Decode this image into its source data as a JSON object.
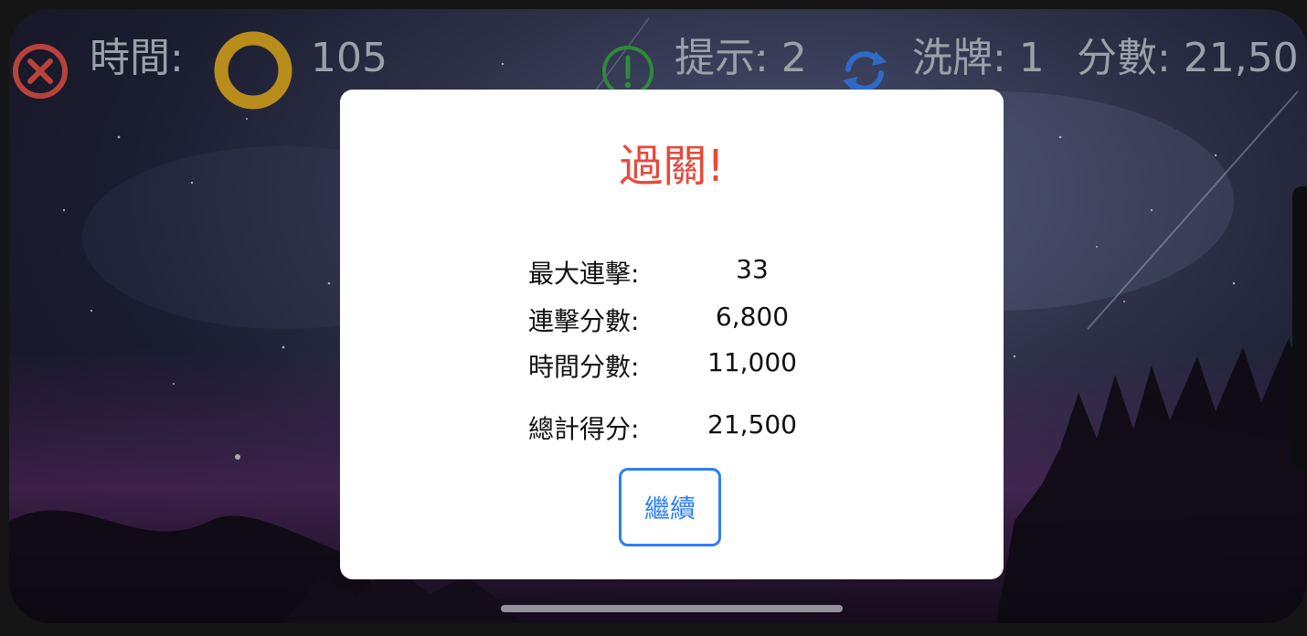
{
  "hud": {
    "time_label": "時間:",
    "time_value": "105",
    "hint_label": "提示: 2",
    "shuffle_label": "洗牌: 1",
    "score_label": "分數: 21,50"
  },
  "modal": {
    "title": "過關!",
    "stats": [
      {
        "label": "最大連擊:",
        "value": "33"
      },
      {
        "label": "連擊分數:",
        "value": "6,800"
      },
      {
        "label": "時間分數:",
        "value": "11,000"
      },
      {
        "label": "總計得分:",
        "value": "21,500"
      }
    ],
    "continue_label": "繼續"
  },
  "colors": {
    "title_red": "#e64a3c",
    "button_blue": "#2d7ef7",
    "close_icon_red": "#b8433a",
    "timer_ring_gold": "#b88d1c",
    "hint_icon_green": "#2f8a3a",
    "shuffle_icon_blue": "#2f6ac8",
    "hud_text": "#9aa1a8"
  },
  "icons": {
    "close": "close-icon",
    "timer": "timer-ring-icon",
    "hint": "hint-icon",
    "shuffle": "shuffle-icon"
  }
}
